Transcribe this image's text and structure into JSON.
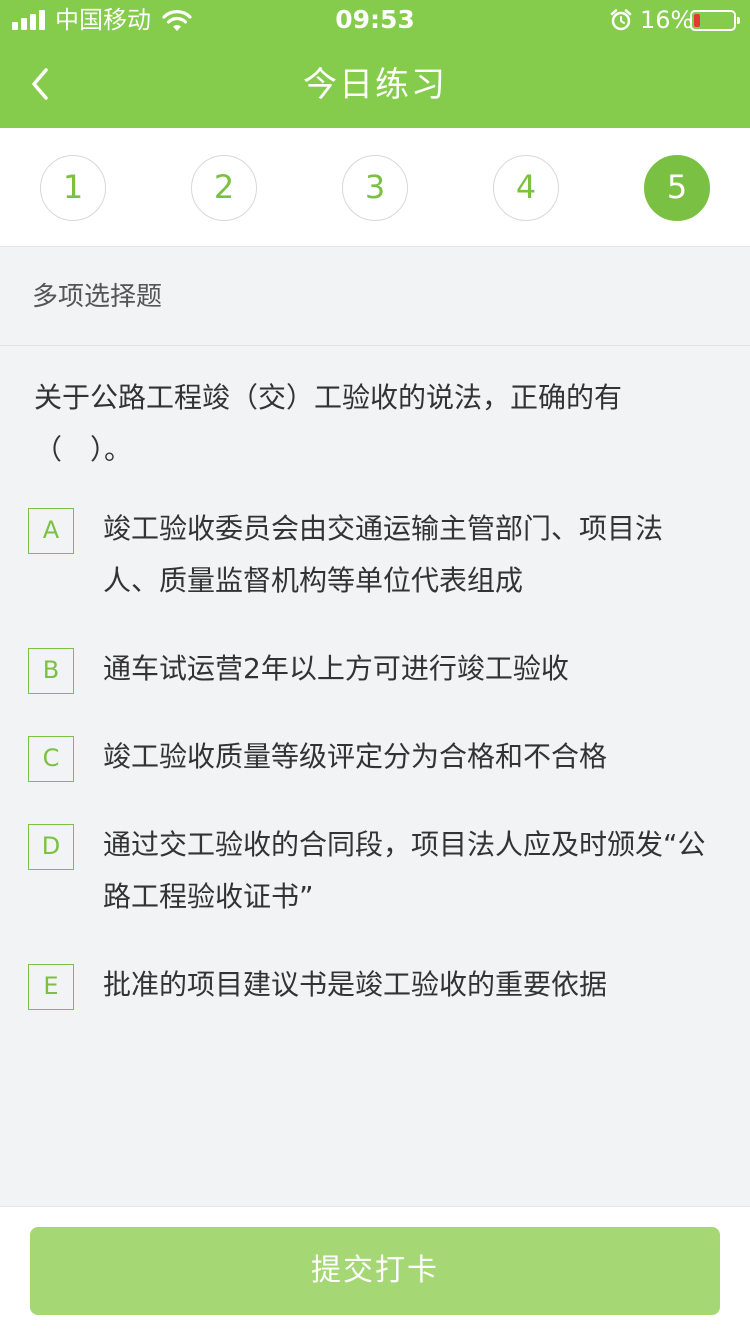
{
  "status_bar": {
    "carrier": "中国移动",
    "time": "09:53",
    "battery_percent": "16%",
    "battery_level": 0.16,
    "icons": [
      "signal-icon",
      "wifi-icon",
      "alarm-icon",
      "battery-icon"
    ]
  },
  "nav": {
    "title": "今日练习",
    "back_icon": "chevron-left-icon"
  },
  "steps": {
    "items": [
      "1",
      "2",
      "3",
      "4",
      "5"
    ],
    "active": "5"
  },
  "question": {
    "type": "多项选择题",
    "text": "关于公路工程竣（交）工验收的说法，正确的有（　）。",
    "options": [
      {
        "letter": "A",
        "text": "竣工验收委员会由交通运输主管部门、项目法人、质量监督机构等单位代表组成"
      },
      {
        "letter": "B",
        "text": "通车试运营2年以上方可进行竣工验收"
      },
      {
        "letter": "C",
        "text": "竣工验收质量等级评定分为合格和不合格"
      },
      {
        "letter": "D",
        "text": "通过交工验收的合同段，项目法人应及时颁发“公路工程验收证书”"
      },
      {
        "letter": "E",
        "text": "批准的项目建议书是竣工验收的重要依据"
      }
    ]
  },
  "footer": {
    "submit_label": "提交打卡"
  },
  "colors": {
    "header_green": "#85cb4c",
    "accent_green": "#7ac143",
    "button_green": "#a5d874",
    "battery_low": "#e33a2f"
  }
}
